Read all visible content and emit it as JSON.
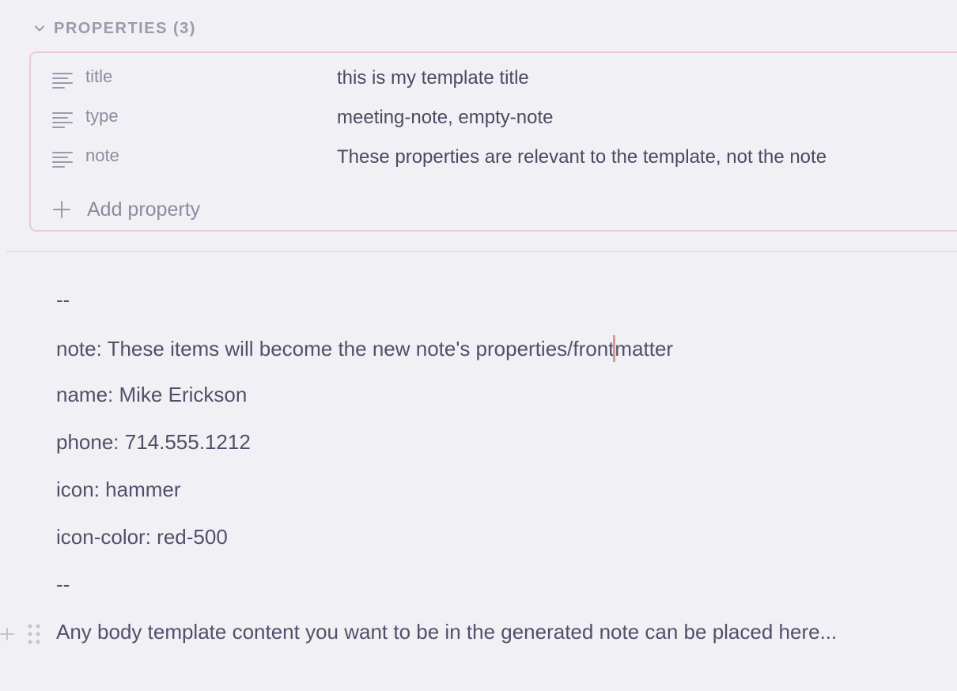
{
  "properties": {
    "header_label": "PROPERTIES (3)",
    "items": [
      {
        "key": "title",
        "value": "this is my template title",
        "icon": "text-lines-icon"
      },
      {
        "key": "type",
        "value": "meeting-note, empty-note",
        "icon": "text-lines-icon"
      },
      {
        "key": "note",
        "value": "These properties are relevant to the template, not the note",
        "icon": "text-lines-icon"
      }
    ],
    "add_label": "Add property"
  },
  "body": {
    "lines": [
      "--",
      "note: These items will become the new note's properties/frontmatter",
      "name: Mike Erickson",
      "phone: 714.555.1212",
      "icon: hammer",
      "icon-color: red-500",
      "--",
      "Any body template content you want to be in the generated note can be placed here..."
    ],
    "caret_line_prefix": "note: These items will become the new note's properties/front",
    "caret_line_suffix": "matter"
  },
  "colors": {
    "background": "#f0f0f5",
    "properties_border": "#ecccd6",
    "caret": "#d89a8e"
  }
}
